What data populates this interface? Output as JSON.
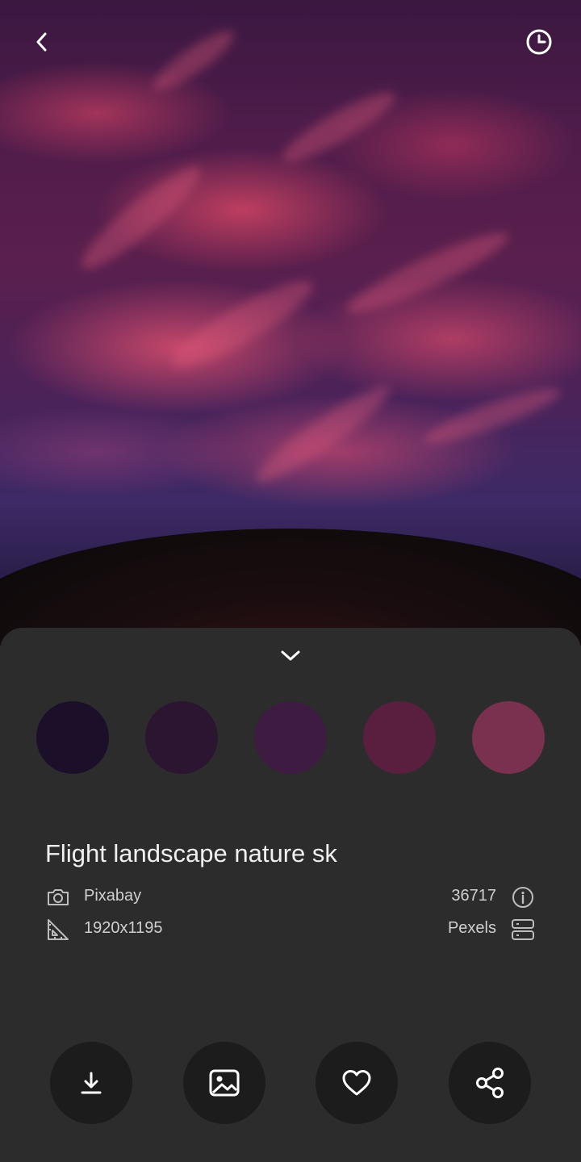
{
  "toolbar": {
    "back_icon": "chevron-left-icon",
    "history_icon": "clock-icon"
  },
  "sheet": {
    "collapse_icon": "chevron-down-icon"
  },
  "palette": [
    "#1b0f2a",
    "#2b1530",
    "#3e1b40",
    "#5a1f3e",
    "#7a3150"
  ],
  "details": {
    "title": "Flight landscape nature sk",
    "source": "Pixabay",
    "resolution": "1920x1195",
    "views": "36717",
    "provider": "Pexels"
  },
  "actions": [
    "download-icon",
    "set-wallpaper-icon",
    "favorite-icon",
    "share-icon"
  ]
}
